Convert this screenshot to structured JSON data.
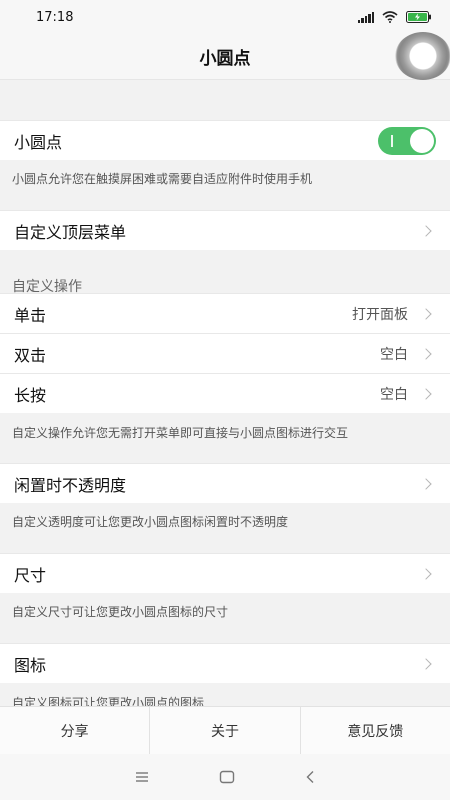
{
  "status_bar": {
    "time": "17:18"
  },
  "header": {
    "title": "小圆点"
  },
  "settings": {
    "dot_toggle": {
      "label": "小圆点",
      "enabled": true
    },
    "dot_desc": "小圆点允许您在触摸屏困难或需要自适应附件时使用手机",
    "custom_top_menu": {
      "label": "自定义顶层菜单"
    },
    "custom_actions_title": "自定义操作",
    "actions": [
      {
        "label": "单击",
        "value": "打开面板"
      },
      {
        "label": "双击",
        "value": "空白"
      },
      {
        "label": "长按",
        "value": "空白"
      }
    ],
    "actions_desc": "自定义操作允许您无需打开菜单即可直接与小圆点图标进行交互",
    "idle_opacity": {
      "label": "闲置时不透明度"
    },
    "opacity_desc": "自定义透明度可让您更改小圆点图标闲置时不透明度",
    "size": {
      "label": "尺寸"
    },
    "size_desc": "自定义尺寸可让您更改小圆点图标的尺寸",
    "icon": {
      "label": "图标"
    },
    "icon_desc": "自定义图标可让您更改小圆点的图标"
  },
  "bottom_tabs": [
    {
      "label": "分享"
    },
    {
      "label": "关于"
    },
    {
      "label": "意见反馈"
    }
  ],
  "colors": {
    "toggle_on": "#4cc06a",
    "background": "#f2f2f2"
  },
  "icons": {
    "nav_menu": "menu-icon",
    "nav_home": "home-icon",
    "nav_back": "back-icon"
  }
}
